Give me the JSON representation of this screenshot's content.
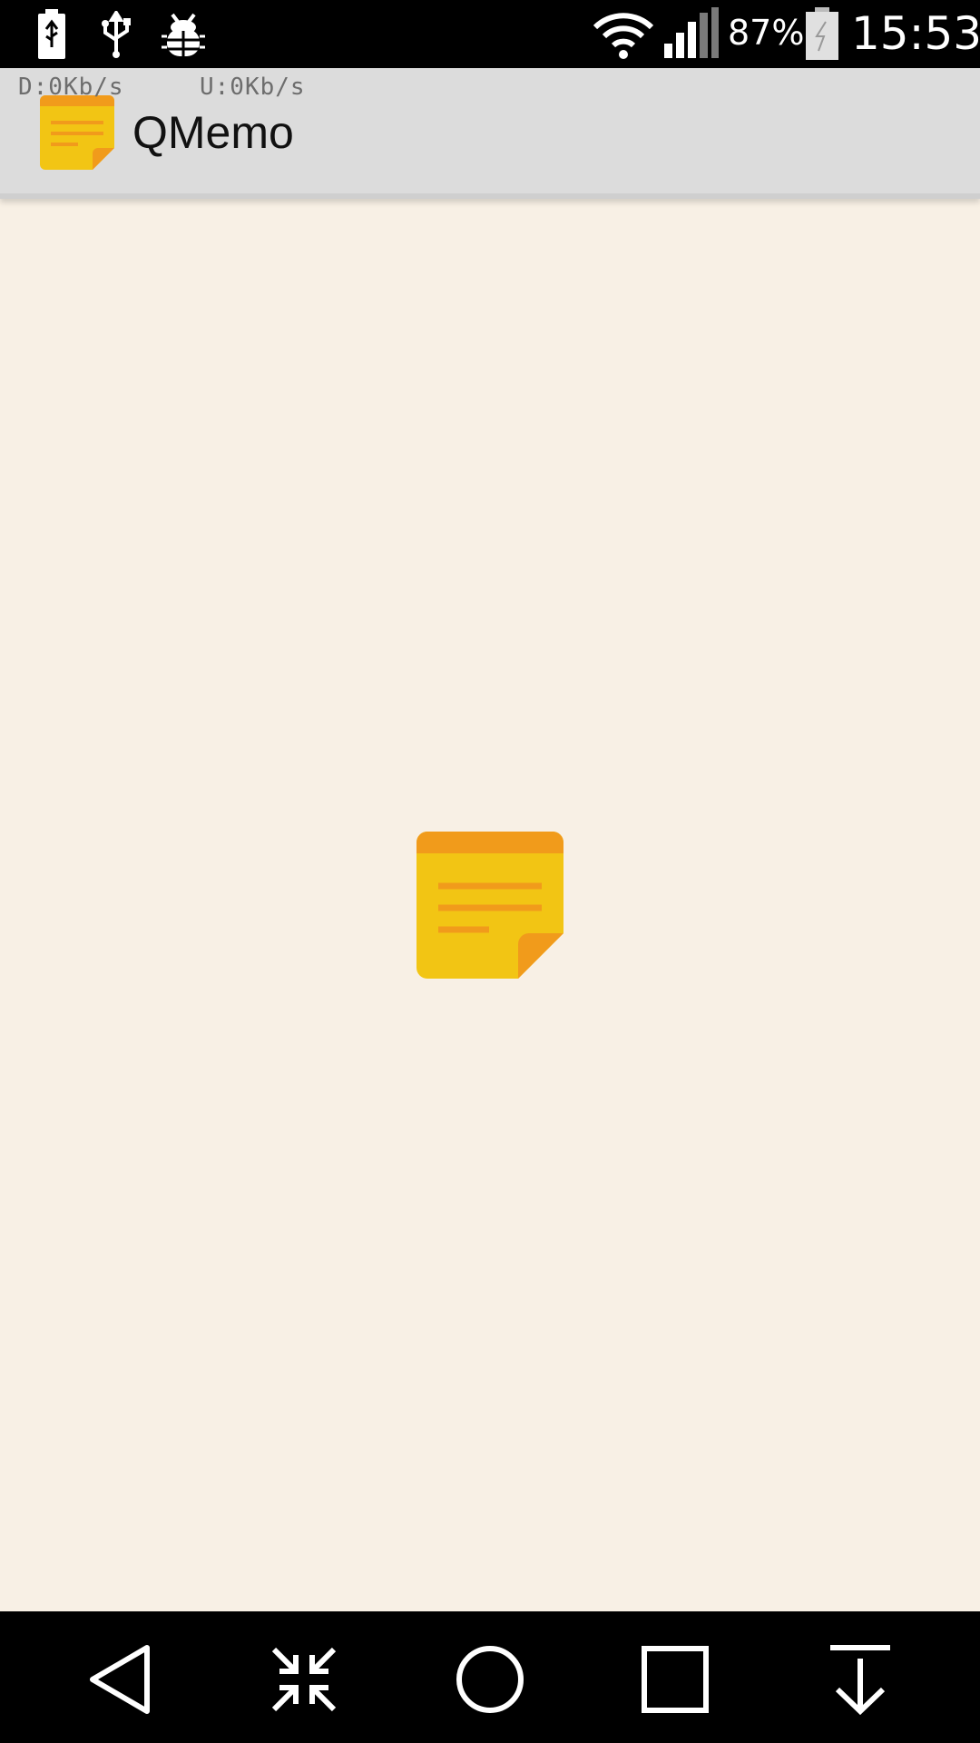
{
  "status_bar": {
    "icons": [
      "battery-charging-usb-icon",
      "usb-icon",
      "debug-bug-icon",
      "wifi-icon",
      "signal-icon",
      "battery-icon"
    ],
    "battery_level": "87%",
    "time": "15:53"
  },
  "app_bar": {
    "download_speed": "D:0Kb/s",
    "upload_speed": "U:0Kb/s",
    "title": "QMemo",
    "icon": "memo-note-icon"
  },
  "main": {
    "splash_icon": "memo-note-icon"
  },
  "nav_bar": {
    "buttons": [
      "back-icon",
      "minimize-icon",
      "home-icon",
      "recents-icon",
      "notification-pull-icon"
    ]
  },
  "colors": {
    "background": "#f8f0e5",
    "app_bar": "#dcdcdc",
    "note_yellow": "#f2c514",
    "note_orange": "#f19b1b"
  }
}
